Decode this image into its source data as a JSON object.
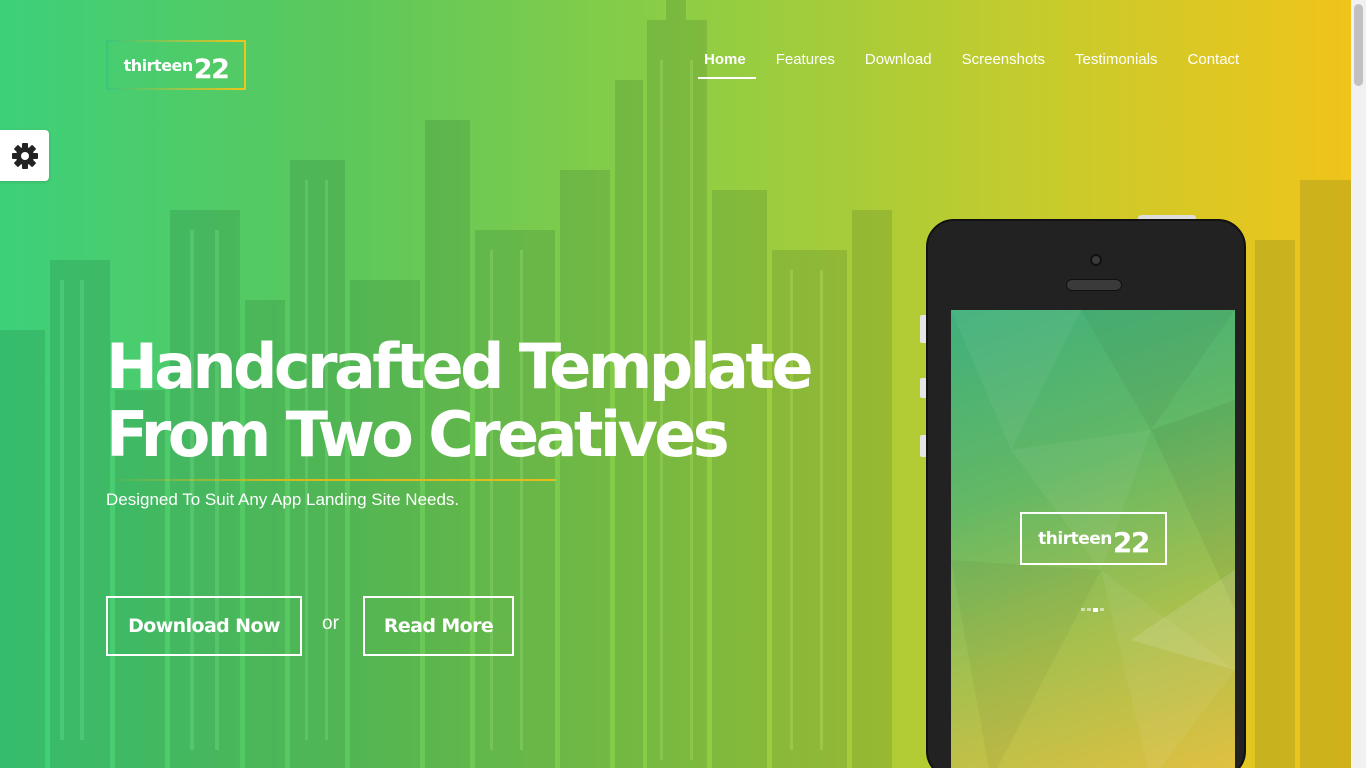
{
  "brand": {
    "word": "thirteen",
    "number": "22"
  },
  "nav": {
    "items": [
      {
        "label": "Home",
        "active": true
      },
      {
        "label": "Features"
      },
      {
        "label": "Download"
      },
      {
        "label": "Screenshots"
      },
      {
        "label": "Testimonials"
      },
      {
        "label": "Contact"
      }
    ]
  },
  "settings": {
    "icon": "gear-icon"
  },
  "hero": {
    "headline_line1": "Handcrafted Template",
    "headline_line2": "From Two Creatives",
    "subline": "Designed To Suit Any App Landing Site Needs.",
    "download_label": "Download Now",
    "or_label": "or",
    "read_more_label": "Read More"
  },
  "phone": {
    "screen_brand": {
      "word": "thirteen",
      "number": "22"
    },
    "loader_dots": 4,
    "loader_active_index": 2
  },
  "colors": {
    "gradient_start": "#3dd07a",
    "gradient_mid": "#8ccd45",
    "gradient_end": "#f0c41b",
    "accent_underline": "#e2bc1b"
  }
}
